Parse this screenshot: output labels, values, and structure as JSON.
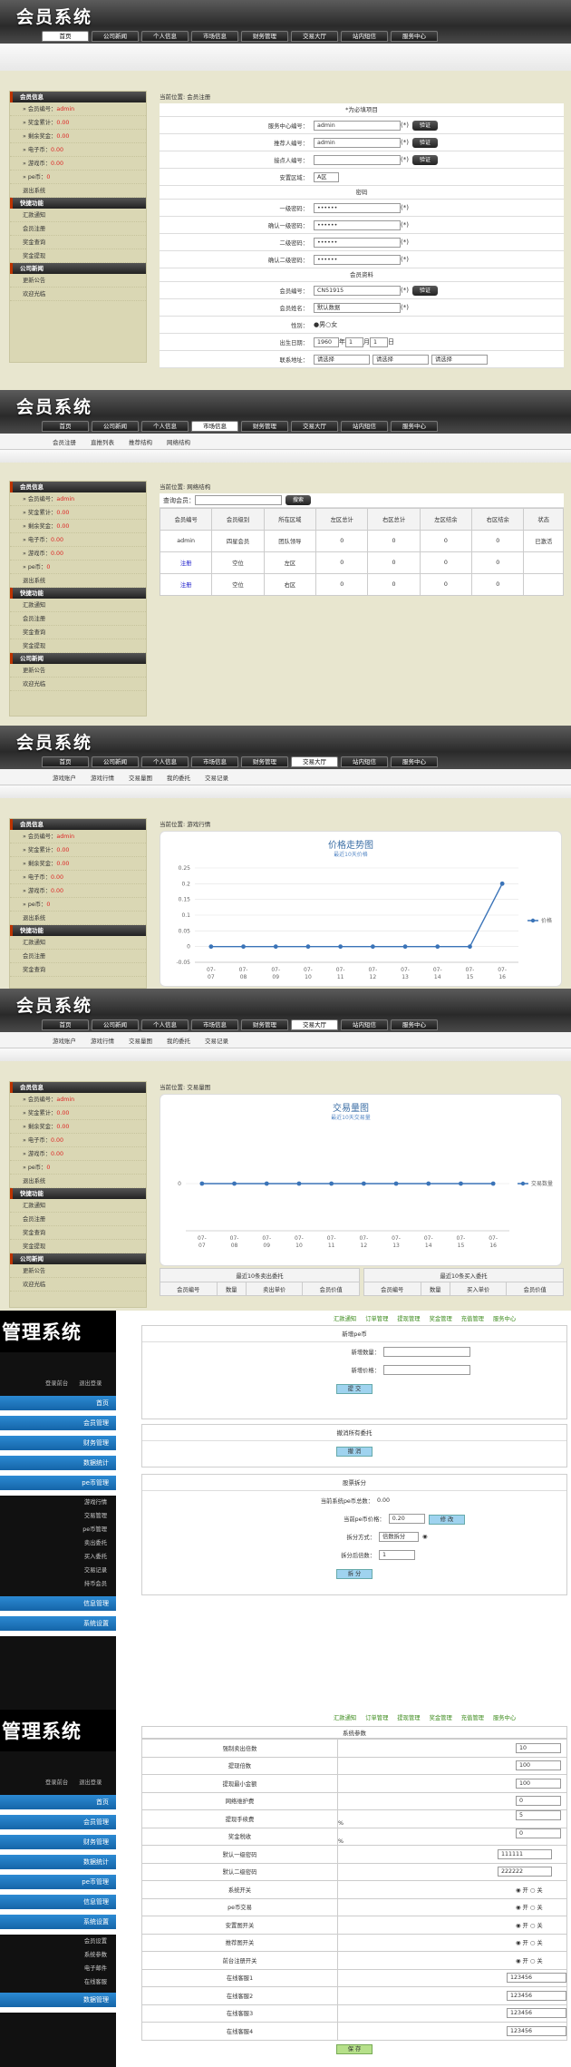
{
  "app_title": "会员系统",
  "nav": [
    "首页",
    "公司新闻",
    "个人信息",
    "市场信息",
    "财务管理",
    "交易大厅",
    "站内短信",
    "服务中心"
  ],
  "sidebar": {
    "info_title": "会员信息",
    "info": [
      {
        "label": "会员编号：",
        "value": "admin"
      },
      {
        "label": "奖金累计：",
        "value": "0.00"
      },
      {
        "label": "剩余奖金：",
        "value": "0.00"
      },
      {
        "label": "电子币：",
        "value": "0.00"
      },
      {
        "label": "游戏币：",
        "value": "0.00"
      },
      {
        "label": "pe币：",
        "value": "0"
      }
    ],
    "logout": "退出系统",
    "quick_title": "快捷功能",
    "quick": [
      "汇款通知",
      "会员注册",
      "奖金查询",
      "奖金提现"
    ],
    "news_title": "公司新闻",
    "news": [
      "更新公告",
      "欢迎光临"
    ]
  },
  "screen1": {
    "location": "当前位置: 会员注册",
    "required_note": "*为必填项目",
    "center_label": "服务中心编号：",
    "center_value": "admin",
    "referrer_label": "推荐人编号：",
    "referrer_value": "admin",
    "contact_label": "接点人编号：",
    "region_label": "安置区域：",
    "region_value": "A区",
    "pwd_section": "密码",
    "pwd1_label": "一级密码：",
    "pwd1_value": "••••••",
    "pwd1c_label": "确认一级密码：",
    "pwd1c_value": "••••••",
    "pwd2_label": "二级密码：",
    "pwd2_value": "••••••",
    "pwd2c_label": "确认二级密码：",
    "pwd2c_value": "••••••",
    "member_section": "会员资料",
    "member_no_label": "会员编号：",
    "member_no_value": "CN51915",
    "member_name_label": "会员姓名：",
    "member_name_value": "默认数据",
    "gender_label": "性别：",
    "gender_male": "男",
    "gender_female": "女",
    "birth_label": "出生日期：",
    "birth_year": "1960",
    "birth_month": "1",
    "birth_day": "1",
    "year_unit": "年",
    "month_unit": "月",
    "day_unit": "日",
    "address_label": "联系地址：",
    "select_placeholder": "请选择",
    "verify_button": "验证"
  },
  "screen2": {
    "subnav": [
      "会员注册",
      "直推列表",
      "推荐结构",
      "网络结构"
    ],
    "location": "当前位置: 网络结构",
    "search_label": "查询会员：",
    "search_button": "搜索",
    "columns": [
      "会员编号",
      "会员级别",
      "所在区域",
      "左区总计",
      "右区总计",
      "左区结余",
      "右区结余",
      "状态"
    ],
    "rows": [
      [
        "admin",
        "四星会员",
        "团队领导",
        "0",
        "0",
        "0",
        "0",
        "已激活"
      ],
      [
        "注册",
        "空位",
        "左区",
        "0",
        "0",
        "0",
        "0",
        ""
      ],
      [
        "注册",
        "空位",
        "右区",
        "0",
        "0",
        "0",
        "0",
        ""
      ]
    ]
  },
  "screen3": {
    "subnav": [
      "游戏账户",
      "游戏行情",
      "交易量图",
      "我的委托",
      "交易记录"
    ],
    "location": "当前位置: 游戏行情",
    "chart_title": "价格走势图",
    "chart_subtitle": "最近10天价格",
    "legend": "价格"
  },
  "screen4": {
    "subnav": [
      "游戏账户",
      "游戏行情",
      "交易量图",
      "我的委托",
      "交易记录"
    ],
    "location": "当前位置: 交易量图",
    "chart_title": "交易量图",
    "chart_subtitle": "最近10天交易量",
    "legend": "交易数量",
    "sell_title": "最近10条卖出委托",
    "buy_title": "最近10条买入委托",
    "sell_cols": [
      "会员编号",
      "数量",
      "卖出单价",
      "会员价值"
    ],
    "buy_cols": [
      "会员编号",
      "数量",
      "买入单价",
      "会员价值"
    ]
  },
  "chart_data": [
    {
      "type": "line",
      "title": "价格走势图",
      "subtitle": "最近10天价格",
      "x": [
        "07-07",
        "07-08",
        "07-09",
        "07-10",
        "07-11",
        "07-12",
        "07-13",
        "07-14",
        "07-15",
        "07-16"
      ],
      "series": [
        {
          "name": "价格",
          "values": [
            0,
            0,
            0,
            0,
            0,
            0,
            0,
            0,
            0,
            0.2
          ]
        }
      ],
      "ylim": [
        -0.05,
        0.25
      ],
      "yticks": [
        "0.25",
        "0.2",
        "0.15",
        "0.1",
        "0.05",
        "0",
        "-0.05"
      ],
      "grid": true,
      "legend": "right"
    },
    {
      "type": "line",
      "title": "交易量图",
      "subtitle": "最近10天交易量",
      "x": [
        "07-07",
        "07-08",
        "07-09",
        "07-10",
        "07-11",
        "07-12",
        "07-13",
        "07-14",
        "07-15",
        "07-16"
      ],
      "series": [
        {
          "name": "交易数量",
          "values": [
            0,
            0,
            0,
            0,
            0,
            0,
            0,
            0,
            0,
            0
          ]
        }
      ],
      "yticks": [
        "0"
      ],
      "grid": true,
      "legend": "right"
    }
  ],
  "admin": {
    "logo": "管理系统",
    "user_links": [
      "登录前台",
      "退出登录"
    ],
    "top_links": [
      "汇款通知",
      "订单管理",
      "提现管理",
      "奖金管理",
      "充值管理",
      "服务中心"
    ],
    "menu1": [
      "首页",
      "会员管理",
      "财务管理",
      "数据统计",
      "pe币管理"
    ],
    "pe_sub": [
      "游戏行情",
      "交易管理",
      "pe币管理",
      "卖出委托",
      "买入委托",
      "交易记录",
      "持币会员"
    ],
    "menu1_tail": [
      "信息管理",
      "系统设置"
    ],
    "new_pe_title": "新增pe币",
    "new_qty_label": "新增数量：",
    "new_price_label": "新增价格：",
    "submit": "提 交",
    "cancel_title": "撤消所有委托",
    "cancel_button": "撤 消",
    "split_title": "股票拆分",
    "total_label": "当前系统pe币总数：",
    "total_value": "0.00",
    "price_label": "当前pe币价格：",
    "price_value": "0.20",
    "modify": "修 改",
    "mode_label": "拆分方式：",
    "mode_value": "倍数拆分",
    "after_label": "拆分后倍数：",
    "after_value": "1",
    "split_button": "拆 分",
    "menu2": [
      "首页",
      "会员管理",
      "财务管理",
      "数据统计",
      "pe币管理",
      "信息管理",
      "系统设置"
    ],
    "sys_sub": [
      "会员设置",
      "系统参数",
      "电子邮件",
      "在线客服"
    ],
    "menu2_tail": [
      "数据管理"
    ],
    "sys_title": "系统参数",
    "params": [
      {
        "k": "强制卖出倍数",
        "v": "10"
      },
      {
        "k": "提现倍数",
        "v": "100"
      },
      {
        "k": "提现最小金额",
        "v": "100"
      },
      {
        "k": "网络维护费",
        "v": "0"
      },
      {
        "k": "提现手续费",
        "v": "5",
        "u": "%"
      },
      {
        "k": "奖金税收",
        "v": "0",
        "u": "%"
      },
      {
        "k": "默认一级密码",
        "v": "111111"
      },
      {
        "k": "默认二级密码",
        "v": "222222"
      }
    ],
    "switches": [
      "系统开关",
      "pe币交易",
      "安置图开关",
      "推荐图开关",
      "前台注册开关"
    ],
    "on": "开",
    "off": "关",
    "qq": [
      {
        "k": "在线客服1",
        "v": "123456"
      },
      {
        "k": "在线客服2",
        "v": "123456"
      },
      {
        "k": "在线客服3",
        "v": "123456"
      },
      {
        "k": "在线客服4",
        "v": "123456"
      }
    ],
    "save": "保 存"
  }
}
